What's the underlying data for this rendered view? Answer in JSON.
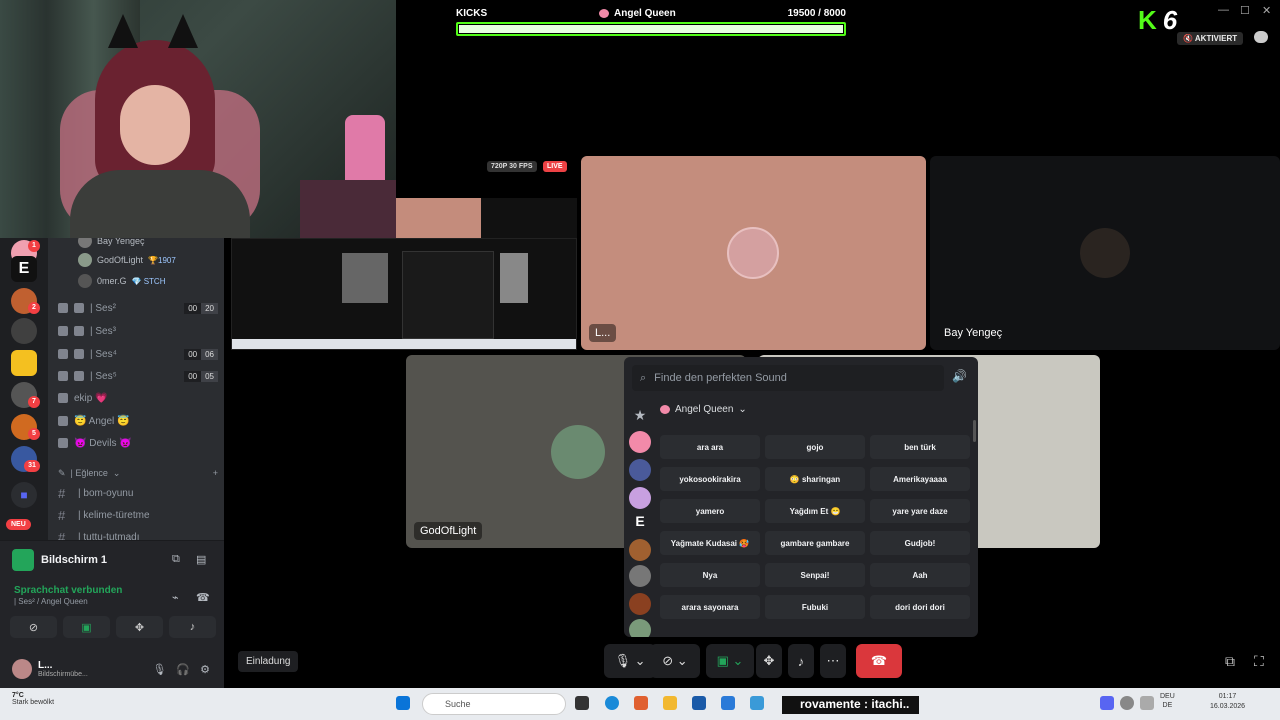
{
  "kicks": {
    "label": "KICKS",
    "user": "Angel Queen",
    "current": 19500,
    "target": 8000,
    "progress_text": "19500  / 8000",
    "progress_fraction": 1.0
  },
  "topright": {
    "logo_k": "K",
    "logo_num": "6",
    "activated": "AKTIVIERT",
    "minimize": "—",
    "maximize": "☐",
    "close": "✕"
  },
  "colors": {
    "kick_green": "#53fc18",
    "discord_green": "#23a55a",
    "danger": "#da373c"
  },
  "guilds": {
    "badges": [
      "1",
      "2",
      "7",
      "5",
      "31"
    ],
    "new_label": "NEU"
  },
  "members": [
    {
      "name": "Bay Yengeç",
      "badge": ""
    },
    {
      "name": "GodOfLight",
      "badge": "🏆1907"
    },
    {
      "name": "0mer.G",
      "badge": "💎 STCH"
    }
  ],
  "voice_channels": [
    {
      "name": "| Ses²",
      "count": "00",
      "limit": "20"
    },
    {
      "name": "| Ses³",
      "count": "",
      "limit": ""
    },
    {
      "name": "| Ses⁴",
      "count": "00",
      "limit": "06"
    },
    {
      "name": "| Ses⁵",
      "count": "00",
      "limit": "05"
    },
    {
      "name": "ekip 💗",
      "count": "",
      "limit": ""
    },
    {
      "name": "😇 Angel 😇",
      "count": "",
      "limit": ""
    },
    {
      "name": "👿 Devils 👿",
      "count": "",
      "limit": ""
    }
  ],
  "category": {
    "name": "| Eğlence",
    "chevron": "⌄",
    "add": "+"
  },
  "text_channels": [
    {
      "name": "| bom-oyunu"
    },
    {
      "name": "| kelime-türetme"
    },
    {
      "name": "| tuttu-tutmadı"
    }
  ],
  "voice_panel": {
    "screen_title": "Bildschirm 1",
    "status": "Sprachchat verbunden",
    "location": "| Ses² / Angel Queen"
  },
  "user": {
    "name": "L...",
    "status": "Bildschirmübe..."
  },
  "stream": {
    "fps_badge": "720P 30 FPS",
    "live_badge": "LIVE"
  },
  "tiles": {
    "tile1_label": "L...",
    "tile2_label": "Bay Yengeç",
    "tile3_label": "GodOfLight"
  },
  "soundboard": {
    "search_placeholder": "Finde den perfekten Sound",
    "section": "Angel Queen",
    "sounds": [
      "ara ara",
      "gojo",
      "ben türk",
      "yokosookirakira",
      "😳 sharingan",
      "Amerikayaaaa",
      "yamero",
      "Yağdım Et 😁",
      "yare yare daze",
      "Yağmate Kudasai 🥵",
      "gambare gambare",
      "Gudjob!",
      "Nya",
      "Senpai!",
      "Aah",
      "arara sayonara",
      "Fubuki",
      "dori dori dori"
    ]
  },
  "bottom": {
    "invite": "Einladung"
  },
  "taskbar": {
    "temp": "7°C",
    "weather": "Stark bewölkt",
    "search": "Suche",
    "ticker": "rovamente : itachi..",
    "lang_top": "DEU",
    "lang_bottom": "DE",
    "time": "01:17",
    "date": "16.03.2026"
  }
}
